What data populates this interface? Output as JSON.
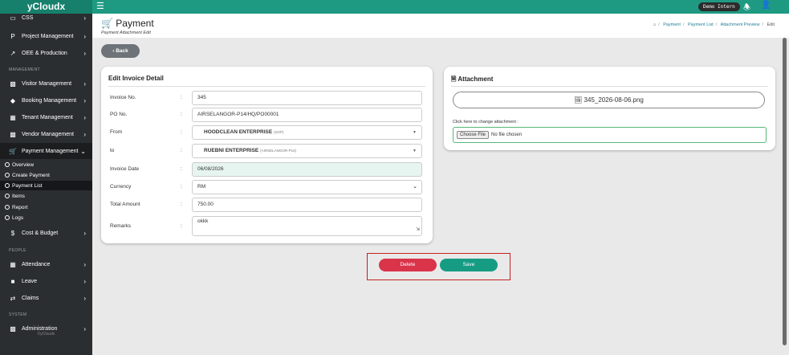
{
  "app": {
    "brand": "yCloudx",
    "demo_badge": "Demo Intern"
  },
  "sidebar": {
    "items": [
      {
        "label": "CSS",
        "icon": "css-icon"
      },
      {
        "label": "Project Management",
        "icon": "project-icon"
      },
      {
        "label": "OEE & Production",
        "icon": "chart-icon"
      },
      {
        "label": "Visitor Management",
        "icon": "id-card-icon"
      },
      {
        "label": "Booking Management",
        "icon": "pin-icon"
      },
      {
        "label": "Tenant Management",
        "icon": "building-icon"
      },
      {
        "label": "Vendor Management",
        "icon": "vendor-card-icon"
      },
      {
        "label": "Payment Management",
        "icon": "cart-icon"
      },
      {
        "label": "Cost & Budget",
        "icon": "dollar-icon"
      },
      {
        "label": "Attendance",
        "icon": "attendance-icon"
      },
      {
        "label": "Leave",
        "icon": "briefcase-icon"
      },
      {
        "label": "Claims",
        "icon": "exchange-icon"
      },
      {
        "label": "Administration",
        "icon": "admin-icon"
      }
    ],
    "headings": {
      "management": "MANAGEMENT",
      "people": "PEOPLE",
      "system": "SYSTEM"
    },
    "payment_sub": [
      "Overview",
      "Create Payment",
      "Payment List",
      "Items",
      "Report",
      "Logs"
    ],
    "footer": "©yCloudx"
  },
  "header": {
    "title": "Payment",
    "subtitle": "Payment Attachment Edit",
    "breadcrumb": [
      "Payment",
      "Payment List",
      "Attachment Preview",
      "Edit"
    ]
  },
  "back_button": "Back",
  "invoice_card": {
    "title": "Edit Invoice Detail",
    "fields": {
      "invoice_no": {
        "label": "Invoice No.",
        "value": "345"
      },
      "po_no": {
        "label": "PO No.",
        "value": "AIRSELANGOR-P14/HQ/PO00001"
      },
      "from": {
        "label": "From",
        "value": "HOODCLEAN ENTERPRISE",
        "tag": "(SOP)"
      },
      "to": {
        "label": "to",
        "value": "RUEBNI ENTERPRISE",
        "tag": "(AIRSELANGOR-P14)"
      },
      "invoice_date": {
        "label": "Invoice Date",
        "value": "06/08/2026"
      },
      "currency": {
        "label": "Currency",
        "value": "RM"
      },
      "total_amount": {
        "label": "Total Amount",
        "value": "750.00"
      },
      "remarks": {
        "label": "Remarks",
        "value": "okkk"
      }
    },
    "colon": ":"
  },
  "attachment_card": {
    "title": "Attachment",
    "file_name": "345_2026-08-06.png",
    "change_label": "Click here to change attachment :",
    "choose_button": "Choose File",
    "no_file": "No file chosen"
  },
  "actions": {
    "delete": "Delete",
    "save": "Save"
  },
  "colors": {
    "topbar": "#1f9a82",
    "sidebar": "#2b2e31",
    "delete": "#d9344a",
    "save": "#179c84"
  }
}
